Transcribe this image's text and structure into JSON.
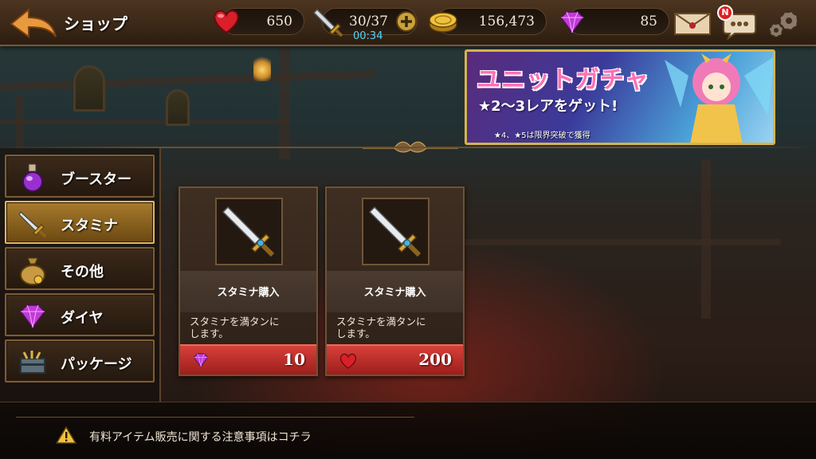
{
  "header": {
    "title": "ショップ",
    "hearts": "650",
    "stamina": "30/37",
    "stamina_timer": "00:34",
    "gold": "156,473",
    "gems": "85",
    "notification_badge": "N"
  },
  "banner": {
    "title": "ユニットガチャ",
    "subtitle": "★2〜3レアをゲット!",
    "note": "★4、★5は限界突破で獲得"
  },
  "side_menu": {
    "items": [
      {
        "label": "ブースター",
        "icon": "potion-icon"
      },
      {
        "label": "スタミナ",
        "icon": "sword-icon"
      },
      {
        "label": "その他",
        "icon": "money-bag-icon"
      },
      {
        "label": "ダイヤ",
        "icon": "gem-icon"
      },
      {
        "label": "パッケージ",
        "icon": "chest-icon"
      }
    ],
    "active_index": 1
  },
  "products": [
    {
      "name": "スタミナ購入",
      "desc_line1": "スタミナを満タンに",
      "desc_line2": "します。",
      "price": "10",
      "currency": "gem-icon"
    },
    {
      "name": "スタミナ購入",
      "desc_line1": "スタミナを満タンに",
      "desc_line2": "します。",
      "price": "200",
      "currency": "heart-icon"
    }
  ],
  "footer": {
    "notice": "有料アイテム販売に関する注意事項はコチラ"
  },
  "colors": {
    "heart": "#d91f2a",
    "gem": "#c13bd6",
    "gold": "#e8b62e",
    "active_tab": "#a77b2c",
    "price_bar": "#c2302b",
    "timer": "#4fd3ff"
  }
}
